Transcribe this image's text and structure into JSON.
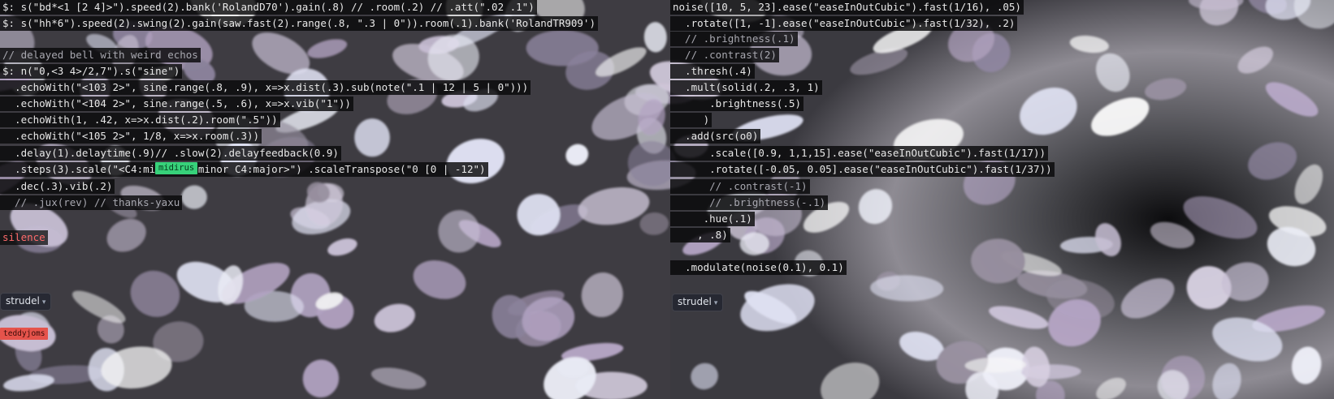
{
  "left_editor": {
    "lines": [
      "$: s(\"bd*<1 [2 4]>\").speed(2).bank('RolandD70').gain(.8) // .room(.2) // .att(\".02 .1\")",
      "$: s(\"hh*6\").speed(2).swing(2).gain(saw.fast(2).range(.8, \".3 | 0\")).room(.1).bank('RolandTR909')",
      "// delayed bell with weird echos",
      "$: n(\"0,<3 4>/2,7\").s(\"sine\")",
      "  .echoWith(\"<103 2>\", sine.range(.8, .9), x=>x.dist(.3).sub(note(\".1 | 12 | 5 | 0\")))",
      "  .echoWith(\"<104 2>\", sine.range(.5, .6), x=>x.vib(\"1\"))",
      "  .echoWith(1, .42, x=>x.dist(.2).room(\".5\"))",
      "  .echoWith(\"<105 2>\", 1/8, x=>x.room(.3))",
      "  .delay(1).delaytime(.9)// .slow(2).delayfeedback(0.9)",
      "  .steps(3).scale(\"<C4:minor C4:minor C4:major>\") .scaleTranspose(\"0 [0 | -12\")",
      "  .dec(.3).vib(.2)",
      "  // .jux(rev) // thanks-yaxu"
    ],
    "status": "silence",
    "cursor_tags": {
      "midirus": "midirus",
      "teddyjoms": "teddyjoms"
    },
    "repl_button": "strudel"
  },
  "right_editor": {
    "lines": [
      "noise([10, 5, 23].ease(\"easeInOutCubic\").fast(1/16), .05)",
      "  .rotate([1, -1].ease(\"easeInOutCubic\").fast(1/32), .2)",
      "  // .brightness(.1)",
      "  // .contrast(2)",
      "  .thresh(.4)",
      "  .mult(solid(.2, .3, 1)",
      "      .brightness(.5)",
      "     )",
      "  .add(src(o0)",
      "      .scale([0.9, 1,1,15].ease(\"easeInOutCubic\").fast(1/17))",
      "      .rotate([-0.05, 0.05].ease(\"easeInOutCubic\").fast(1/37))",
      "      // .contrast(-1)",
      "      // .brightness(-.1)",
      "     .hue(.1)",
      "    , .8)",
      "  .modulate(noise(0.1), 0.1)"
    ],
    "repl_button": "strudel"
  },
  "colors": {
    "accent_green": "#37d17a",
    "status_red": "#ff6b6b",
    "tag_red": "#e5534b"
  }
}
